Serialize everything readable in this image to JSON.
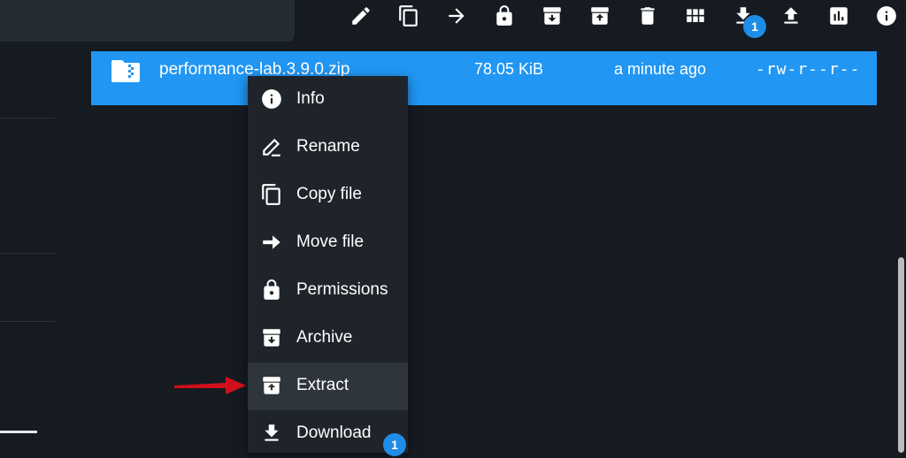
{
  "toolbar": {
    "buttons": [
      {
        "name": "rename",
        "icon": "pencil-icon"
      },
      {
        "name": "copy",
        "icon": "copy-icon"
      },
      {
        "name": "move",
        "icon": "arrow-right-icon"
      },
      {
        "name": "permissions",
        "icon": "lock-icon"
      },
      {
        "name": "archive",
        "icon": "archive-icon"
      },
      {
        "name": "extract",
        "icon": "unarchive-icon"
      },
      {
        "name": "delete",
        "icon": "trash-icon"
      },
      {
        "name": "view-mode",
        "icon": "grid-icon"
      },
      {
        "name": "download",
        "icon": "download-icon"
      },
      {
        "name": "upload",
        "icon": "upload-icon"
      },
      {
        "name": "usage",
        "icon": "bar-chart-icon"
      },
      {
        "name": "info",
        "icon": "info-icon"
      }
    ],
    "download_badge": "1"
  },
  "file": {
    "name": "performance-lab.3.9.0.zip",
    "size": "78.05 KiB",
    "modified": "a minute ago",
    "permissions": "-rw-r--r--",
    "icon": "zip-folder-icon"
  },
  "context_menu": {
    "items": [
      {
        "label": "Info",
        "icon": "info-icon"
      },
      {
        "label": "Rename",
        "icon": "pencil-icon"
      },
      {
        "label": "Copy file",
        "icon": "copy-icon"
      },
      {
        "label": "Move file",
        "icon": "arrow-right-icon"
      },
      {
        "label": "Permissions",
        "icon": "lock-icon"
      },
      {
        "label": "Archive",
        "icon": "archive-icon"
      },
      {
        "label": "Extract",
        "icon": "unarchive-icon",
        "highlighted": true
      },
      {
        "label": "Download",
        "icon": "download-icon"
      }
    ],
    "download_badge": "1"
  },
  "colors": {
    "background": "#161b22",
    "selected_row": "#2196f3",
    "menu_bg": "#1f242b",
    "menu_highlight": "#2f353d",
    "badge": "#1f8ce6",
    "annotation_arrow": "#d0101b"
  }
}
